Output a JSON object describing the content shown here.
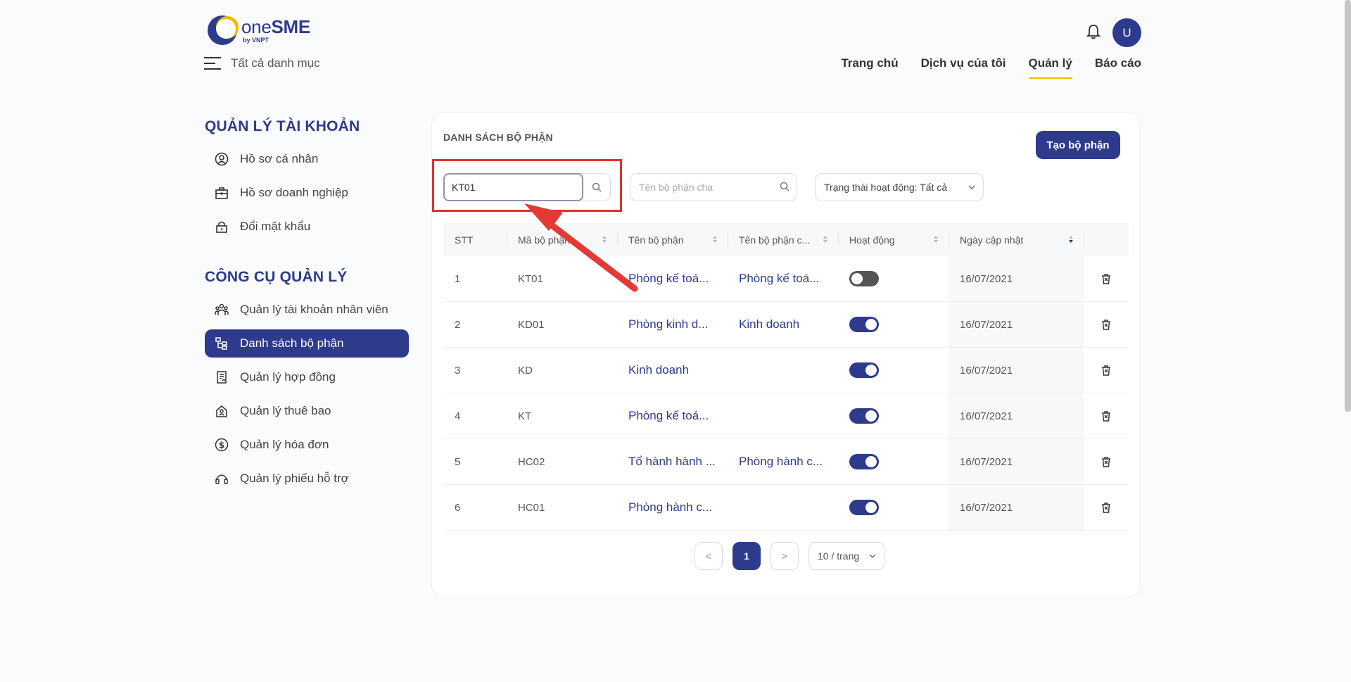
{
  "brand": {
    "name_light": "one",
    "name_bold": "SME",
    "sub": "by VNPT"
  },
  "header": {
    "all_categories": "Tất cả danh mục",
    "nav": [
      "Trang chủ",
      "Dịch vụ của tôi",
      "Quản lý",
      "Báo cáo"
    ],
    "active_nav": "Quản lý",
    "avatar_initial": "U"
  },
  "sidebar": {
    "account_title": "QUẢN LÝ TÀI KHOẢN",
    "account_items": [
      {
        "label": "Hồ sơ cá nhân",
        "icon": "user-circle-icon"
      },
      {
        "label": "Hồ sơ doanh nghiệp",
        "icon": "briefcase-icon"
      },
      {
        "label": "Đổi mật khẩu",
        "icon": "lock-icon"
      }
    ],
    "tools_title": "CÔNG CỤ QUẢN LÝ",
    "tools_items": [
      {
        "label": "Quản lý tài khoản nhân viên",
        "icon": "users-icon"
      },
      {
        "label": "Danh sách bộ phận",
        "icon": "tree-icon",
        "active": true
      },
      {
        "label": "Quản lý hợp đồng",
        "icon": "contract-icon"
      },
      {
        "label": "Quản lý thuê bao",
        "icon": "home-icon"
      },
      {
        "label": "Quản lý hóa đơn",
        "icon": "dollar-icon"
      },
      {
        "label": "Quản lý phiếu hỗ trợ",
        "icon": "headset-icon"
      }
    ]
  },
  "main": {
    "title": "DANH SÁCH BỘ PHẬN",
    "create_button": "Tạo bộ phận",
    "search_code_value": "KT01",
    "search_parent_placeholder": "Tên bộ phận cha",
    "status_filter": "Trạng thái hoạt động: Tất cả",
    "columns": [
      "STT",
      "Mã bộ phận",
      "Tên bộ phận",
      "Tên bộ phận c...",
      "Hoạt động",
      "Ngày cập nhật"
    ],
    "rows": [
      {
        "stt": "1",
        "code": "KT01",
        "name": "Phòng kế toá...",
        "parent": "Phòng kế toá...",
        "active": false,
        "date": "16/07/2021"
      },
      {
        "stt": "2",
        "code": "KD01",
        "name": "Phòng kinh d...",
        "parent": "Kinh doanh",
        "active": true,
        "date": "16/07/2021"
      },
      {
        "stt": "3",
        "code": "KD",
        "name": "Kinh doanh",
        "parent": "",
        "active": true,
        "date": "16/07/2021"
      },
      {
        "stt": "4",
        "code": "KT",
        "name": "Phòng kế toá...",
        "parent": "",
        "active": true,
        "date": "16/07/2021"
      },
      {
        "stt": "5",
        "code": "HC02",
        "name": "Tổ hành hành ...",
        "parent": "Phòng hành c...",
        "active": true,
        "date": "16/07/2021"
      },
      {
        "stt": "6",
        "code": "HC01",
        "name": "Phòng hành c...",
        "parent": "",
        "active": true,
        "date": "16/07/2021"
      }
    ],
    "pagination": {
      "prev": "<",
      "current": "1",
      "next": ">",
      "page_size": "10 / trang"
    }
  },
  "colors": {
    "primary": "#2e3a8c",
    "accent": "#f2b900",
    "highlight": "#e0302e"
  }
}
